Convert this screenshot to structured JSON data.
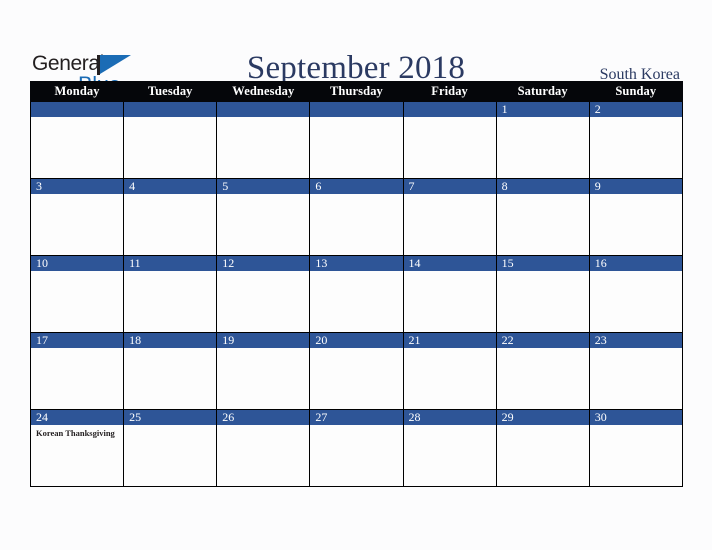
{
  "logo": {
    "word_one": "General",
    "word_two": "Blue",
    "flag_color": "#1b6cb5",
    "text_color": "#231f20"
  },
  "header": {
    "title": "September 2018",
    "country": "South Korea",
    "title_color": "#2b3a62"
  },
  "calendar": {
    "header_bg": "#05060a",
    "daynum_bg": "#2e5597",
    "weekday_headers": [
      "Monday",
      "Tuesday",
      "Wednesday",
      "Thursday",
      "Friday",
      "Saturday",
      "Sunday"
    ],
    "weeks": [
      [
        {
          "num": "",
          "events": ""
        },
        {
          "num": "",
          "events": ""
        },
        {
          "num": "",
          "events": ""
        },
        {
          "num": "",
          "events": ""
        },
        {
          "num": "",
          "events": ""
        },
        {
          "num": "1",
          "events": ""
        },
        {
          "num": "2",
          "events": ""
        }
      ],
      [
        {
          "num": "3",
          "events": ""
        },
        {
          "num": "4",
          "events": ""
        },
        {
          "num": "5",
          "events": ""
        },
        {
          "num": "6",
          "events": ""
        },
        {
          "num": "7",
          "events": ""
        },
        {
          "num": "8",
          "events": ""
        },
        {
          "num": "9",
          "events": ""
        }
      ],
      [
        {
          "num": "10",
          "events": ""
        },
        {
          "num": "11",
          "events": ""
        },
        {
          "num": "12",
          "events": ""
        },
        {
          "num": "13",
          "events": ""
        },
        {
          "num": "14",
          "events": ""
        },
        {
          "num": "15",
          "events": ""
        },
        {
          "num": "16",
          "events": ""
        }
      ],
      [
        {
          "num": "17",
          "events": ""
        },
        {
          "num": "18",
          "events": ""
        },
        {
          "num": "19",
          "events": ""
        },
        {
          "num": "20",
          "events": ""
        },
        {
          "num": "21",
          "events": ""
        },
        {
          "num": "22",
          "events": ""
        },
        {
          "num": "23",
          "events": ""
        }
      ],
      [
        {
          "num": "24",
          "events": "Korean Thanksgiving"
        },
        {
          "num": "25",
          "events": ""
        },
        {
          "num": "26",
          "events": ""
        },
        {
          "num": "27",
          "events": ""
        },
        {
          "num": "28",
          "events": ""
        },
        {
          "num": "29",
          "events": ""
        },
        {
          "num": "30",
          "events": ""
        }
      ]
    ]
  }
}
